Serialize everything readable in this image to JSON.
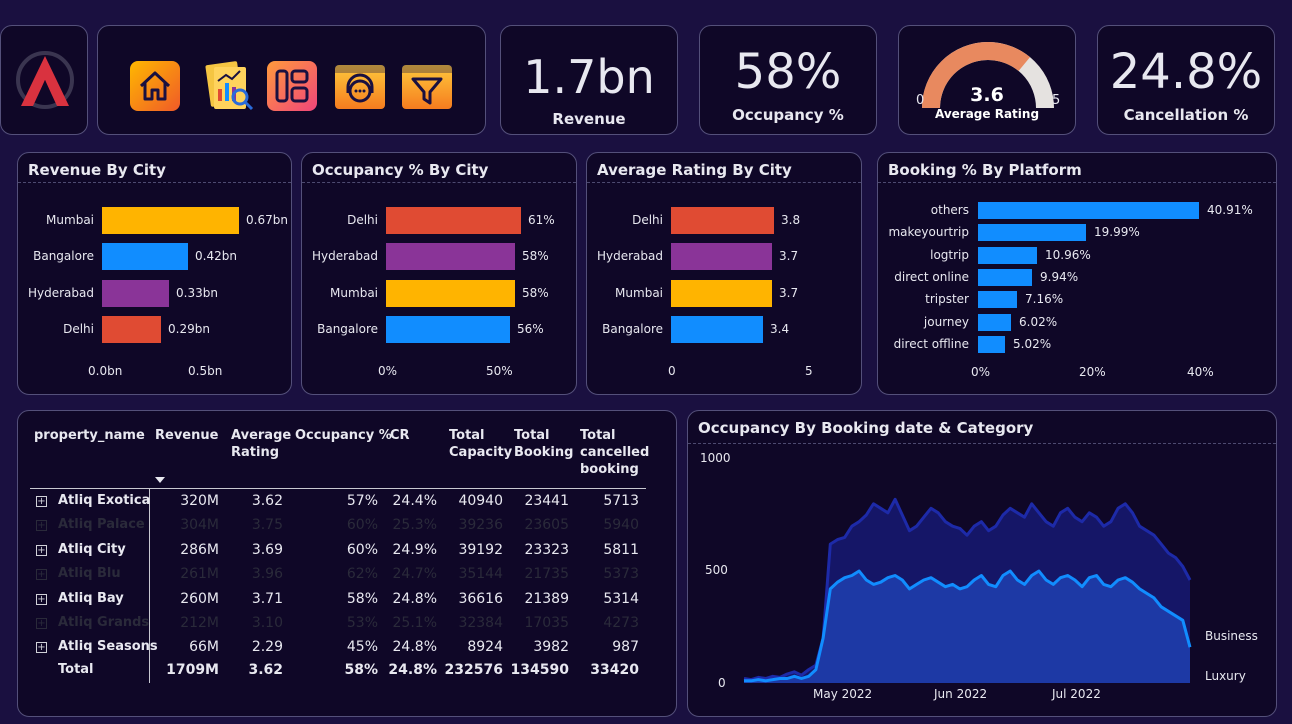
{
  "nav": {
    "logo": "company-logo",
    "icons": [
      "home-icon",
      "report-analysis-icon",
      "dashboard-layout-icon",
      "customer-support-icon",
      "filter-funnel-icon"
    ]
  },
  "kpis": {
    "revenue": {
      "value": "1.7bn",
      "label": "Revenue"
    },
    "occupancy": {
      "value": "58%",
      "label": "Occupancy %"
    },
    "rating": {
      "value": "3.6",
      "label": "Average Rating",
      "min": "0",
      "max": "5",
      "fraction": 0.72
    },
    "cancellation": {
      "value": "24.8%",
      "label": "Cancellation %"
    }
  },
  "colors": {
    "card_bg": "#0f0727",
    "page_bg": "#1a1040",
    "yellow": "#ffb400",
    "blue": "#118dff",
    "purple": "#8a3498",
    "red": "#e04b33",
    "gauge": "#e8895f"
  },
  "revenue_by_city": {
    "title": "Revenue By City",
    "ticks": [
      "0.0bn",
      "0.5bn"
    ],
    "rows": [
      {
        "city": "Mumbai",
        "value": 0.67,
        "label": "0.67bn",
        "color": "#ffb400"
      },
      {
        "city": "Bangalore",
        "value": 0.42,
        "label": "0.42bn",
        "color": "#118dff"
      },
      {
        "city": "Hyderabad",
        "value": 0.33,
        "label": "0.33bn",
        "color": "#8a3498"
      },
      {
        "city": "Delhi",
        "value": 0.29,
        "label": "0.29bn",
        "color": "#e04b33"
      }
    ]
  },
  "occupancy_by_city": {
    "title": "Occupancy % By City",
    "ticks": [
      "0%",
      "50%"
    ],
    "rows": [
      {
        "city": "Delhi",
        "value": 61,
        "label": "61%",
        "color": "#e04b33"
      },
      {
        "city": "Hyderabad",
        "value": 58,
        "label": "58%",
        "color": "#8a3498"
      },
      {
        "city": "Mumbai",
        "value": 58,
        "label": "58%",
        "color": "#ffb400"
      },
      {
        "city": "Bangalore",
        "value": 56,
        "label": "56%",
        "color": "#118dff"
      }
    ]
  },
  "rating_by_city": {
    "title": "Average Rating By City",
    "ticks": [
      "0",
      "5"
    ],
    "rows": [
      {
        "city": "Delhi",
        "value": 3.8,
        "label": "3.8",
        "color": "#e04b33"
      },
      {
        "city": "Hyderabad",
        "value": 3.7,
        "label": "3.7",
        "color": "#8a3498"
      },
      {
        "city": "Mumbai",
        "value": 3.7,
        "label": "3.7",
        "color": "#ffb400"
      },
      {
        "city": "Bangalore",
        "value": 3.4,
        "label": "3.4",
        "color": "#118dff"
      }
    ]
  },
  "booking_by_platform": {
    "title": "Booking % By Platform",
    "ticks": [
      "0%",
      "20%",
      "40%"
    ],
    "rows": [
      {
        "platform": "others",
        "value": 40.91,
        "label": "40.91%"
      },
      {
        "platform": "makeyourtrip",
        "value": 19.99,
        "label": "19.99%"
      },
      {
        "platform": "logtrip",
        "value": 10.96,
        "label": "10.96%"
      },
      {
        "platform": "direct online",
        "value": 9.94,
        "label": "9.94%"
      },
      {
        "platform": "tripster",
        "value": 7.16,
        "label": "7.16%"
      },
      {
        "platform": "journey",
        "value": 6.02,
        "label": "6.02%"
      },
      {
        "platform": "direct offline",
        "value": 5.02,
        "label": "5.02%"
      }
    ]
  },
  "table": {
    "headers": [
      "property_name",
      "Revenue",
      "Average Rating",
      "Occupancy %",
      "CR",
      "Total Capacity",
      "Total Booking",
      "Total cancelled booking"
    ],
    "rows": [
      {
        "name": "Atliq Exotica",
        "revenue": "320M",
        "rating": "3.62",
        "occupancy": "57%",
        "cr": "24.4%",
        "capacity": "40940",
        "booking": "23441",
        "cancelled": "5713",
        "dim": false
      },
      {
        "name": "Atliq Palace",
        "revenue": "304M",
        "rating": "3.75",
        "occupancy": "60%",
        "cr": "25.3%",
        "capacity": "39236",
        "booking": "23605",
        "cancelled": "5940",
        "dim": true
      },
      {
        "name": "Atliq City",
        "revenue": "286M",
        "rating": "3.69",
        "occupancy": "60%",
        "cr": "24.9%",
        "capacity": "39192",
        "booking": "23323",
        "cancelled": "5811",
        "dim": false
      },
      {
        "name": "Atliq Blu",
        "revenue": "261M",
        "rating": "3.96",
        "occupancy": "62%",
        "cr": "24.7%",
        "capacity": "35144",
        "booking": "21735",
        "cancelled": "5373",
        "dim": true
      },
      {
        "name": "Atliq Bay",
        "revenue": "260M",
        "rating": "3.71",
        "occupancy": "58%",
        "cr": "24.8%",
        "capacity": "36616",
        "booking": "21389",
        "cancelled": "5314",
        "dim": false
      },
      {
        "name": "Atliq Grands",
        "revenue": "212M",
        "rating": "3.10",
        "occupancy": "53%",
        "cr": "25.1%",
        "capacity": "32384",
        "booking": "17035",
        "cancelled": "4273",
        "dim": true
      },
      {
        "name": "Atliq Seasons",
        "revenue": "66M",
        "rating": "2.29",
        "occupancy": "45%",
        "cr": "24.8%",
        "capacity": "8924",
        "booking": "3982",
        "cancelled": "987",
        "dim": false
      }
    ],
    "total": {
      "name": "Total",
      "revenue": "1709M",
      "rating": "3.62",
      "occupancy": "58%",
      "cr": "24.8%",
      "capacity": "232576",
      "booking": "134590",
      "cancelled": "33420"
    }
  },
  "chart_data": {
    "type": "area",
    "title": "Occupancy By Booking date & Category",
    "x_ticks": [
      "May 2022",
      "Jun 2022",
      "Jul 2022"
    ],
    "y_ticks": [
      "0",
      "500",
      "1000"
    ],
    "ylim": [
      0,
      1000
    ],
    "series": [
      {
        "name": "Business",
        "color": "#1d2aa8",
        "values": [
          20,
          15,
          25,
          20,
          30,
          25,
          40,
          50,
          35,
          60,
          80,
          200,
          620,
          640,
          650,
          700,
          720,
          750,
          800,
          780,
          760,
          820,
          750,
          680,
          700,
          740,
          780,
          760,
          720,
          700,
          690,
          660,
          700,
          720,
          680,
          700,
          750,
          780,
          760,
          740,
          800,
          760,
          720,
          700,
          760,
          780,
          740,
          720,
          760,
          740,
          700,
          720,
          780,
          800,
          760,
          700,
          680,
          660,
          620,
          580,
          560,
          520,
          460
        ]
      },
      {
        "name": "Luxury",
        "color": "#118dff",
        "values": [
          10,
          10,
          15,
          10,
          15,
          20,
          20,
          30,
          20,
          30,
          60,
          200,
          420,
          450,
          470,
          480,
          500,
          460,
          440,
          450,
          470,
          480,
          460,
          420,
          440,
          460,
          470,
          450,
          430,
          440,
          420,
          430,
          460,
          480,
          440,
          430,
          480,
          500,
          460,
          440,
          480,
          500,
          460,
          440,
          470,
          480,
          460,
          430,
          470,
          480,
          440,
          430,
          460,
          470,
          450,
          420,
          400,
          380,
          340,
          320,
          300,
          280,
          160
        ]
      }
    ]
  }
}
